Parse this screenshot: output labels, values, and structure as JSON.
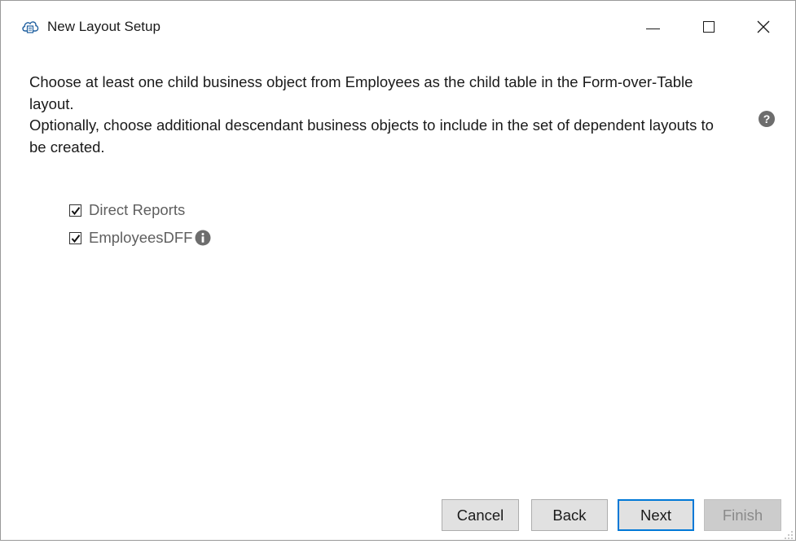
{
  "window": {
    "title": "New Layout Setup",
    "controls": {
      "minimize": "minimize",
      "maximize": "maximize",
      "close": "close"
    }
  },
  "instructions": {
    "line1": "Choose at least one child business object from Employees as the child table in the Form-over-Table layout.",
    "line2": "Optionally, choose additional descendant business objects to include in the set of dependent layouts to be created."
  },
  "options": [
    {
      "label": "Direct Reports",
      "checked": true,
      "info": false
    },
    {
      "label": "EmployeesDFF",
      "checked": true,
      "info": true
    }
  ],
  "buttons": {
    "cancel": "Cancel",
    "back": "Back",
    "next": "Next",
    "finish": "Finish"
  },
  "icons": {
    "app": "cloud-layout-icon",
    "help": "question-mark-icon",
    "info": "info-icon"
  },
  "colors": {
    "accent": "#0078d7",
    "icon_gray": "#6d6d6d"
  }
}
